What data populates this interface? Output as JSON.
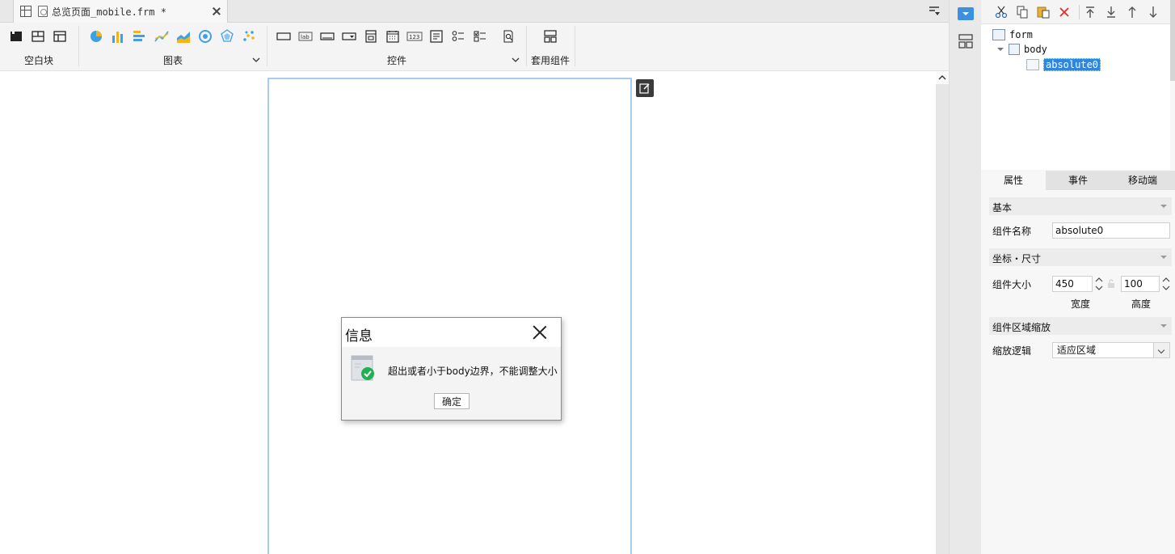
{
  "tab": {
    "title": "总览页面_mobile.frm *"
  },
  "ribbon": {
    "groups": [
      {
        "label": "空白块"
      },
      {
        "label": "图表"
      },
      {
        "label": "控件"
      },
      {
        "label": "套用组件"
      }
    ],
    "control_labels": {
      "label_widget": "lab",
      "number_widget": "123"
    }
  },
  "dialog": {
    "title": "信息",
    "message": "超出或者小于body边界，不能调整大小",
    "ok_label": "确定"
  },
  "tree": {
    "nodes": [
      {
        "label": "form"
      },
      {
        "label": "body"
      },
      {
        "label": "absolute0"
      }
    ]
  },
  "props": {
    "tabs": [
      "属性",
      "事件",
      "移动端"
    ],
    "sections": {
      "basic": "基本",
      "position": "坐标・尺寸",
      "scale": "组件区域缩放"
    },
    "name_label": "组件名称",
    "name_value": "absolute0",
    "size_label": "组件大小",
    "width_value": "450",
    "height_value": "100",
    "width_label": "宽度",
    "height_label": "高度",
    "scale_label": "缩放逻辑",
    "scale_value": "适应区域"
  },
  "colors": {
    "accent": "#3d8fe0",
    "frame": "#a8ccef",
    "success": "#1fb050"
  }
}
